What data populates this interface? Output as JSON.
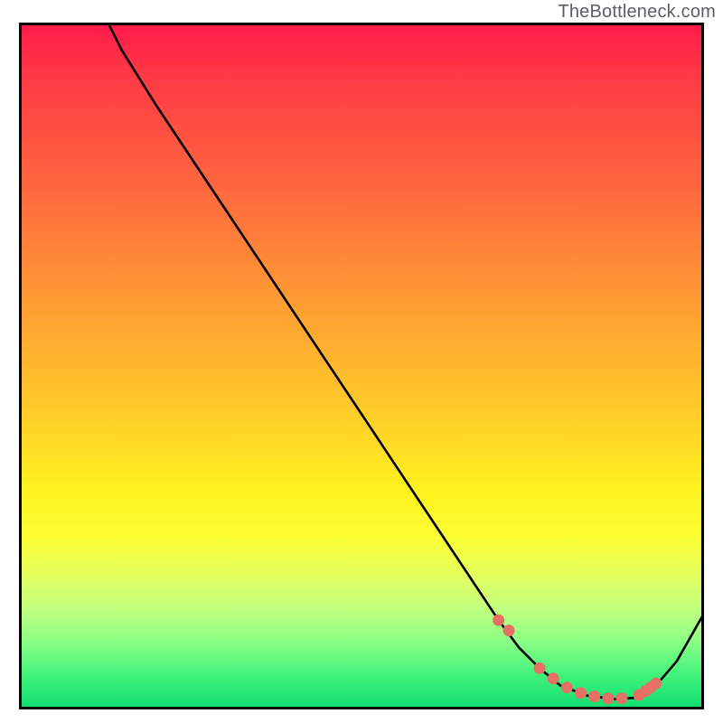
{
  "attribution": "TheBottleneck.com",
  "colors": {
    "gradient_top": "#ff1a4a",
    "gradient_mid": "#fff21e",
    "gradient_bottom": "#0fdc70",
    "curve": "#000000",
    "dots": "#e77065",
    "frame": "#000000"
  },
  "chart_data": {
    "type": "line",
    "title": "",
    "xlabel": "",
    "ylabel": "",
    "x_range": [
      0,
      100
    ],
    "y_range": [
      0,
      100
    ],
    "description": "Bottleneck-curve style plot with rainbow vertical gradient background. Black curve descends from top-left, flattens into a trough near the bottom-right, then rises at the right edge. Salmon dots mark the flat optimum region along the trough.",
    "series": [
      {
        "name": "bottleneck_curve",
        "x": [
          13,
          15,
          20,
          28,
          36,
          44,
          52,
          58,
          62,
          66,
          70,
          73,
          76,
          79,
          83,
          87,
          90,
          93,
          96,
          100
        ],
        "y": [
          100,
          96,
          88,
          76,
          64,
          52,
          40,
          31,
          25,
          19,
          13,
          9,
          6,
          3.5,
          2,
          1.5,
          1.7,
          3.5,
          7,
          14
        ]
      }
    ],
    "optimum_dots": {
      "name": "optimum_region_dots",
      "x": [
        70,
        71.5,
        76,
        78,
        80,
        82,
        84,
        86,
        88,
        90.5,
        91.5,
        92.2,
        93
      ],
      "y": [
        13,
        11.5,
        6,
        4.5,
        3.2,
        2.4,
        1.9,
        1.6,
        1.6,
        2.1,
        2.7,
        3.2,
        3.8
      ]
    }
  }
}
